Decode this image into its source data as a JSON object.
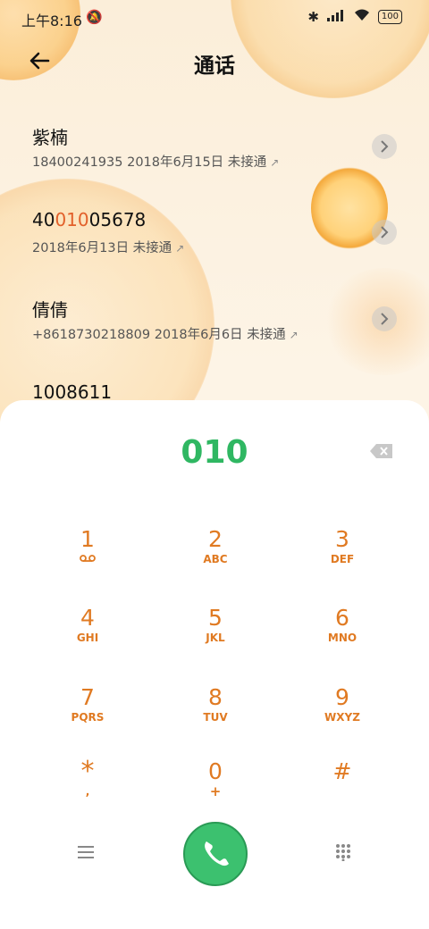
{
  "status_bar": {
    "time": "上午8:16",
    "battery": "100"
  },
  "header": {
    "title": "通话"
  },
  "calls": [
    {
      "name_parts": [
        "紫楠",
        "",
        ""
      ],
      "detail": "18400241935 2018年6月15日 未接通"
    },
    {
      "name_parts": [
        "40",
        "010",
        "05678"
      ],
      "detail": "2018年6月13日 未接通"
    },
    {
      "name_parts": [
        "倩倩",
        "",
        ""
      ],
      "detail": "+8618730218809 2018年6月6日 未接通"
    },
    {
      "name_parts": [
        "1008611",
        "",
        ""
      ],
      "detail": ""
    }
  ],
  "dialer": {
    "number": "010",
    "keys": [
      {
        "digit": "1",
        "letters": ""
      },
      {
        "digit": "2",
        "letters": "ABC"
      },
      {
        "digit": "3",
        "letters": "DEF"
      },
      {
        "digit": "4",
        "letters": "GHI"
      },
      {
        "digit": "5",
        "letters": "JKL"
      },
      {
        "digit": "6",
        "letters": "MNO"
      },
      {
        "digit": "7",
        "letters": "PQRS"
      },
      {
        "digit": "8",
        "letters": "TUV"
      },
      {
        "digit": "9",
        "letters": "WXYZ"
      },
      {
        "digit": "*",
        "letters": ","
      },
      {
        "digit": "0",
        "letters": "+"
      },
      {
        "digit": "#",
        "letters": ""
      }
    ]
  },
  "colors": {
    "accent": "#e07a22",
    "highlight": "#e2602a",
    "number": "#2fb762",
    "call": "#3cc16f"
  }
}
